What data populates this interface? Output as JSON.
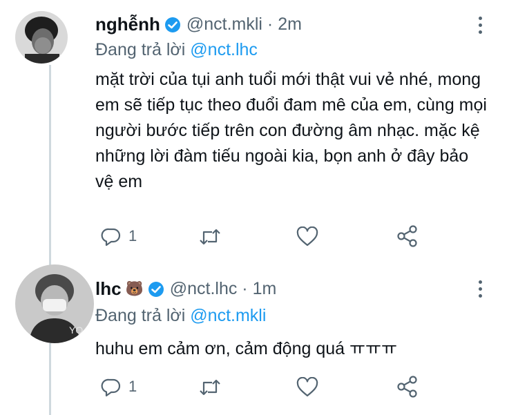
{
  "tweets": [
    {
      "name": "nghễnh",
      "handle": "@nct.mkli · 2m",
      "reply_prefix": "Đang trả lời",
      "reply_to": "@nct.mkli",
      "reply_to_display": "@nct.lhc",
      "text": "mặt trời của tụi anh tuổi mới thật vui vẻ nhé, mong em sẽ tiếp tục theo đuổi đam mê của em, cùng mọi người bước tiếp trên con đường âm nhạc. mặc kệ những lời đàm tiếu ngoài kia, bọn anh ở đây bảo vệ em",
      "reply_count": "1",
      "icons": [
        "reply-icon",
        "retweet-icon",
        "like-icon",
        "share-icon"
      ]
    },
    {
      "name": "lhc",
      "emoji": "🐻",
      "handle": "@nct.lhc · 1m",
      "reply_prefix": "Đang trả lời",
      "reply_to_display": "@nct.mkli",
      "text": "huhu em cảm ơn, cảm động quá ㅠㅠㅠ",
      "reply_count": "1",
      "icons": [
        "reply-icon",
        "retweet-icon",
        "like-icon",
        "share-icon"
      ]
    }
  ],
  "colors": {
    "accent": "#1d9bf0",
    "secondary_text": "#536471",
    "primary_text": "#0f1419",
    "thread_line": "#cfd9de"
  }
}
